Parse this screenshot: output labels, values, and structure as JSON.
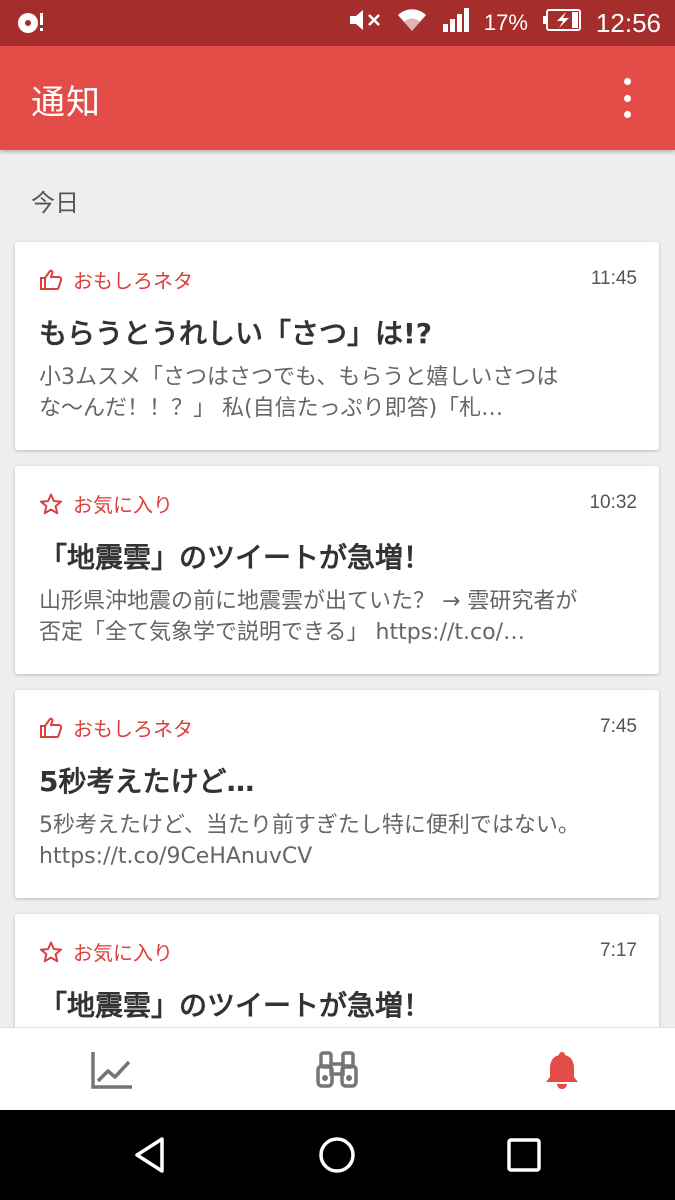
{
  "status_bar": {
    "battery": "17%",
    "clock": "12:56"
  },
  "app_bar": {
    "title": "通知"
  },
  "section": {
    "label": "今日"
  },
  "notifications": [
    {
      "category": "おもしろネタ",
      "category_icon": "thumbs-up-icon",
      "time": "11:45",
      "headline": "もらうとうれしい「さつ」は!?",
      "body": "小3ムスメ「さつはさつでも、もらうと嬉しいさつはな〜んだ！！？」 私(自信たっぷり即答)「札…"
    },
    {
      "category": "お気に入り",
      "category_icon": "star-icon",
      "time": "10:32",
      "headline": "「地震雲」のツイートが急増！",
      "body": "山形県沖地震の前に地震雲が出ていた？ → 雲研究者が否定「全て気象学で説明できる」 https://t.co/…"
    },
    {
      "category": "おもしろネタ",
      "category_icon": "thumbs-up-icon",
      "time": "7:45",
      "headline": "5秒考えたけど…",
      "body": "5秒考えたけど、当たり前すぎたし特に便利ではない。 https://t.co/9CeHAnuvCV"
    },
    {
      "category": "お気に入り",
      "category_icon": "star-icon",
      "time": "7:17",
      "headline": "「地震雲」のツイートが急増！",
      "body": ""
    }
  ],
  "bottom_nav": [
    {
      "icon": "trending-chart-icon",
      "active": false
    },
    {
      "icon": "binoculars-icon",
      "active": false
    },
    {
      "icon": "bell-icon",
      "active": true
    }
  ],
  "colors": {
    "primary": "#e44c48",
    "status_bar": "#a52e2c",
    "accent_text": "#d8403c",
    "inactive_icon": "#757575"
  }
}
